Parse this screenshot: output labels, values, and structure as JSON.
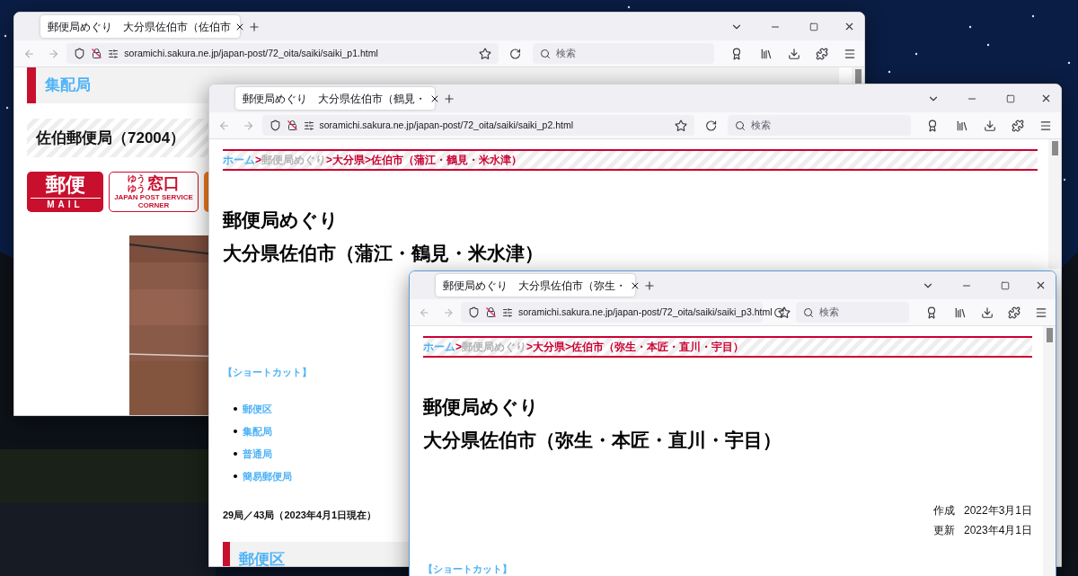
{
  "windows": [
    {
      "focused": false,
      "tab": {
        "title": "郵便局めぐり　大分県佐伯市（佐伯市",
        "selected": true
      },
      "url": "soramichi.sakura.ne.jp/japan-post/72_oita/saiki/saiki_p1.html",
      "search": {
        "placeholder": "検索"
      },
      "page": {
        "kind": "office",
        "section_heading": "集配局",
        "office_heading": "佐伯郵便局（72004）",
        "logos": [
          {
            "kind": "mail",
            "texts": [
              "郵便",
              "MAIL"
            ]
          },
          {
            "kind": "counter",
            "texts": [
              "ゆう",
              "ゆう",
              "窓口",
              "JAPAN POST SERVICE CORNER"
            ]
          },
          {
            "kind": "orange"
          }
        ]
      }
    },
    {
      "focused": false,
      "tab": {
        "title": "郵便局めぐり　大分県佐伯市（鶴見・",
        "selected": true
      },
      "url": "soramichi.sakura.ne.jp/japan-post/72_oita/saiki/saiki_p2.html",
      "search": {
        "placeholder": "検索"
      },
      "page": {
        "kind": "area",
        "breadcrumb": [
          {
            "text": "ホーム",
            "kind": "link"
          },
          {
            "text": ">",
            "kind": "sep"
          },
          {
            "text": "郵便局めぐり",
            "kind": "visited"
          },
          {
            "text": ">",
            "kind": "sep"
          },
          {
            "text": "大分県",
            "kind": "current"
          },
          {
            "text": ">",
            "kind": "sep"
          },
          {
            "text": "佐伯市（蒲江・鶴見・米水津）",
            "kind": "current"
          }
        ],
        "title_lines": [
          "郵便局めぐり",
          "大分県佐伯市（蒲江・鶴見・米水津）"
        ],
        "shortcut_label": "【ショートカット】",
        "shortcuts": [
          "郵便区",
          "集配局",
          "普通局",
          "簡易郵便局"
        ],
        "count": "29局／43局（2023年4月1日現在）",
        "section_heading": "郵便区"
      }
    },
    {
      "focused": true,
      "tab": {
        "title": "郵便局めぐり　大分県佐伯市（弥生・",
        "selected": true
      },
      "url": "soramichi.sakura.ne.jp/japan-post/72_oita/saiki/saiki_p3.html",
      "search": {
        "placeholder": "検索"
      },
      "page": {
        "kind": "area",
        "breadcrumb": [
          {
            "text": "ホーム",
            "kind": "link"
          },
          {
            "text": ">",
            "kind": "sep"
          },
          {
            "text": "郵便局めぐり",
            "kind": "visited"
          },
          {
            "text": ">",
            "kind": "sep"
          },
          {
            "text": "大分県",
            "kind": "current"
          },
          {
            "text": ">",
            "kind": "sep"
          },
          {
            "text": "佐伯市（弥生・本匠・直川・宇目）",
            "kind": "current"
          }
        ],
        "title_lines": [
          "郵便局めぐり",
          "大分県佐伯市（弥生・本匠・直川・宇目）"
        ],
        "dates": [
          {
            "label": "作成",
            "value": "2022年3月1日"
          },
          {
            "label": "更新",
            "value": "2023年4月1日"
          }
        ],
        "shortcut_label": "【ショートカット】"
      }
    }
  ]
}
